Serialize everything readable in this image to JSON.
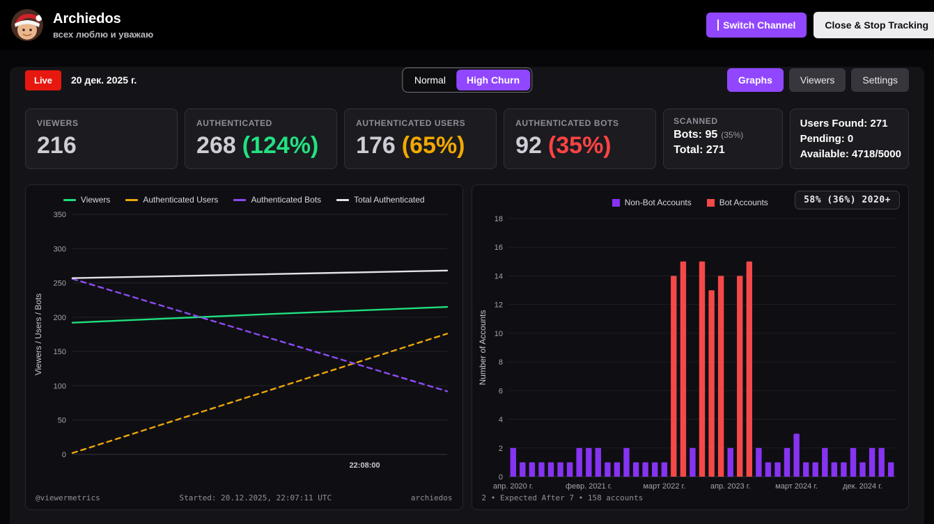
{
  "colors": {
    "accent_purple": "#9147ff",
    "green": "#22e181",
    "orange": "#f2a900",
    "red": "#ff4343",
    "live_red": "#e6180f",
    "bar_purple": "#8633f2",
    "bar_red": "#f54848"
  },
  "header": {
    "title": "Archiedos",
    "subtitle": "всех люблю и уважаю",
    "switch_channel_label": "Switch Channel",
    "close_stop_label": "Close & Stop Tracking"
  },
  "toolbar": {
    "live_label": "Live",
    "date": "20 дек. 2025 г.",
    "mode_normal": "Normal",
    "mode_high_churn": "High Churn",
    "tab_graphs": "Graphs",
    "tab_viewers": "Viewers",
    "tab_settings": "Settings"
  },
  "stats": {
    "viewers": {
      "label": "VIEWERS",
      "value": "216"
    },
    "authenticated": {
      "label": "AUTHENTICATED",
      "value": "268",
      "percent": "(124%)"
    },
    "auth_users": {
      "label": "AUTHENTICATED USERS",
      "value": "176",
      "percent": "(65%)"
    },
    "auth_bots": {
      "label": "AUTHENTICATED BOTS",
      "value": "92",
      "percent": "(35%)"
    },
    "scanned": {
      "label": "SCANNED",
      "bots": "Bots: 95",
      "bots_percent": "(35%)",
      "total": "Total: 271"
    },
    "found": {
      "line1": "Users Found: 271",
      "line2": "Pending: 0",
      "line3": "Available: 4718/5000"
    }
  },
  "chart_data": [
    {
      "type": "line",
      "title": "",
      "ylabel": "Viewers / Users / Bots",
      "ylim": [
        0,
        350
      ],
      "yticks": [
        0,
        50,
        100,
        150,
        200,
        250,
        300,
        350
      ],
      "xticks": [
        {
          "pos": 0.78,
          "label": "22:08:00"
        }
      ],
      "grid": "horizontal",
      "legend_position": "top",
      "series": [
        {
          "name": "Viewers",
          "color": "#1fe07e",
          "dashed": false,
          "points": [
            [
              0,
              192
            ],
            [
              0.5,
              204
            ],
            [
              1,
              215
            ]
          ]
        },
        {
          "name": "Authenticated Users",
          "color": "#eda609",
          "dashed": true,
          "points": [
            [
              0,
              2
            ],
            [
              1,
              176
            ]
          ]
        },
        {
          "name": "Authenticated Bots",
          "color": "#8d4bf4",
          "dashed": true,
          "points": [
            [
              0,
              256
            ],
            [
              1,
              92
            ]
          ]
        },
        {
          "name": "Total Authenticated",
          "color": "#e4e4e8",
          "dashed": false,
          "points": [
            [
              0,
              257
            ],
            [
              1,
              268
            ]
          ]
        }
      ],
      "footer_left": "@viewermetrics",
      "footer_center": "Started: 20.12.2025, 22:07:11 UTC",
      "footer_right": "archiedos"
    },
    {
      "type": "bar",
      "title": "",
      "ylabel": "Number of Accounts",
      "ylim": [
        0,
        18
      ],
      "yticks": [
        0,
        2,
        4,
        6,
        8,
        10,
        12,
        14,
        16,
        18
      ],
      "badge": "58% (36%) 2020+",
      "legend_position": "top",
      "legend": [
        {
          "label": "Non-Bot Accounts",
          "color": "#8633f2",
          "type": "user"
        },
        {
          "label": "Bot Accounts",
          "color": "#f54848",
          "type": "bot"
        }
      ],
      "values": [
        2,
        1,
        1,
        1,
        1,
        1,
        1,
        2,
        2,
        2,
        1,
        1,
        2,
        1,
        1,
        1,
        1,
        14,
        15,
        2,
        15,
        13,
        14,
        2,
        14,
        15,
        2,
        1,
        1,
        2,
        3,
        1,
        1,
        2,
        1,
        1,
        2,
        1,
        2,
        2,
        1
      ],
      "bot_indices": [
        17,
        18,
        20,
        21,
        22,
        24,
        25
      ],
      "xticks": [
        {
          "index": 0,
          "label": "апр. 2020 г."
        },
        {
          "index": 8,
          "label": "февр. 2021 г."
        },
        {
          "index": 16,
          "label": "март 2022 г."
        },
        {
          "index": 23,
          "label": "апр. 2023 г."
        },
        {
          "index": 30,
          "label": "март 2024 г."
        },
        {
          "index": 37,
          "label": "дек. 2024 г."
        }
      ],
      "footer": "2 • Expected After 7 • 158 accounts"
    }
  ]
}
